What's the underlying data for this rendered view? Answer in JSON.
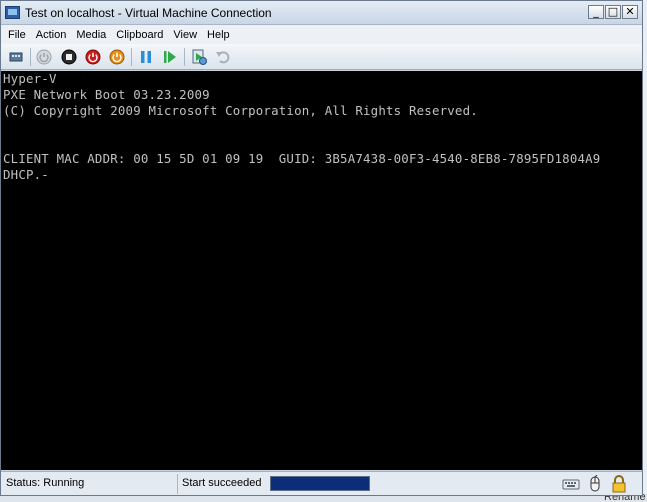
{
  "window": {
    "title": "Test on localhost - Virtual Machine Connection",
    "buttons": {
      "minimize": "_",
      "maximize": "□",
      "close": "✕"
    }
  },
  "menu": [
    "File",
    "Action",
    "Media",
    "Clipboard",
    "View",
    "Help"
  ],
  "toolbar": [
    {
      "name": "ctrl-alt-del-icon"
    },
    {
      "name": "start-icon",
      "disabled": true
    },
    {
      "name": "turn-off-icon"
    },
    {
      "name": "shut-down-icon"
    },
    {
      "name": "save-icon"
    },
    {
      "name": "pause-icon"
    },
    {
      "name": "resume-icon"
    },
    {
      "name": "snapshot-icon"
    },
    {
      "name": "revert-icon",
      "disabled": true
    }
  ],
  "console": {
    "lines": [
      "Hyper-V",
      "PXE Network Boot 03.23.2009",
      "(C) Copyright 2009 Microsoft Corporation, All Rights Reserved.",
      "",
      "",
      "CLIENT MAC ADDR: 00 15 5D 01 09 19  GUID: 3B5A7438-00F3-4540-8EB8-7895FD1804A9",
      "DHCP.-"
    ],
    "text_color": "#c0c0c0",
    "background": "#000000"
  },
  "status": {
    "state": "Status: Running",
    "message": "Start succeeded",
    "progress": 1.0,
    "icons": [
      "keyboard-icon",
      "mouse-icon",
      "lock-icon"
    ]
  },
  "background": {
    "peek_text": "Rename"
  }
}
